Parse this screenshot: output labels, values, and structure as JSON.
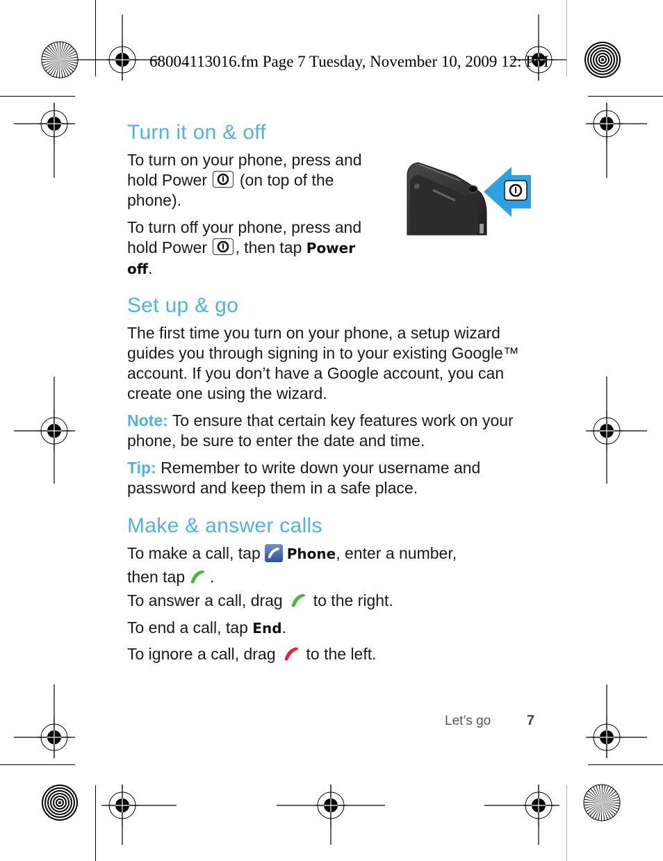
{
  "slug": "68004113016.fm  Page 7  Tuesday, November 10, 2009  12:  PM",
  "sections": {
    "turn_on_off": {
      "heading": "Turn it on & off",
      "p1": {
        "before": "To turn on your phone, press and hold Power",
        "after": "(on top of the phone)."
      },
      "p2": {
        "before": "To turn off your phone, press and hold Power",
        "middle": ", then tap",
        "bold": "Power off",
        "after": "."
      },
      "illustration": "phone-top-power-key-illustration"
    },
    "setup": {
      "heading": "Set up & go",
      "p1": "The first time you turn on your phone, a setup wizard guides you through signing in to your existing Google™ account. If you don’t have a Google account, you can create one using the wizard.",
      "note_label": "Note:",
      "note_text": "To ensure that certain key features work on your phone, be sure to enter the date and time.",
      "tip_label": "Tip:",
      "tip_text": "Remember to write down your username and password and keep them in a safe place."
    },
    "calls": {
      "heading": "Make & answer calls",
      "make": {
        "before": "To make a call, tap",
        "bold": "Phone",
        "middle": ", enter a number,",
        "line2": "then tap",
        "after": "."
      },
      "answer": {
        "before": "To answer a call, drag",
        "after": "to the right."
      },
      "end": {
        "before": "To end a call, tap",
        "bold": "End",
        "after": "."
      },
      "ignore": {
        "before": "To ignore a call, drag",
        "after": "to the left."
      }
    }
  },
  "footer": {
    "section_title": "Let’s go",
    "page_number": "7"
  },
  "colors": {
    "heading": "#4db3e6",
    "answer_green": "#4cb83c",
    "ignore_red": "#e8232b",
    "phone_app_blue": "#3f63b5"
  }
}
